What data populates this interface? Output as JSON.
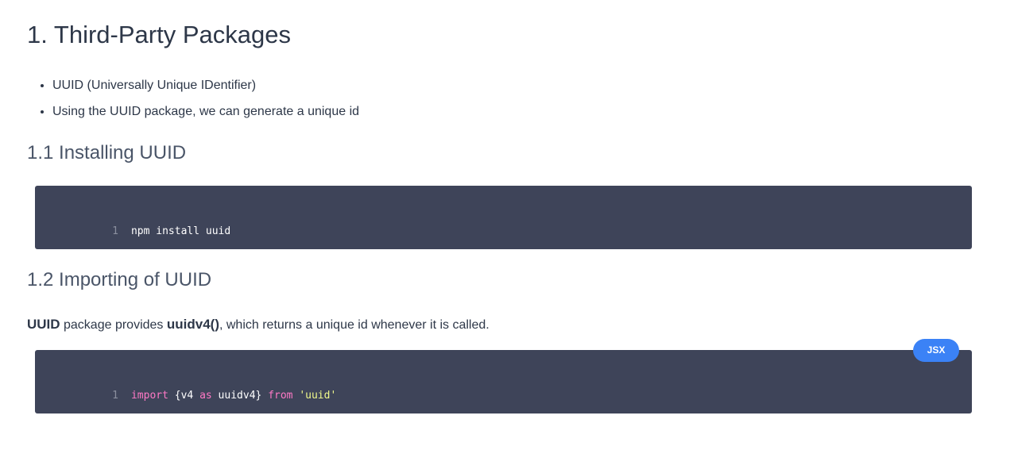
{
  "heading": "1. Third-Party Packages",
  "bullets": [
    "UUID (Universally Unique IDentifier)",
    "Using the UUID package, we can generate a unique id"
  ],
  "section1": {
    "title": "1.1 Installing UUID",
    "code": {
      "line_number": "1",
      "text": "npm install uuid"
    }
  },
  "section2": {
    "title": "1.2 Importing of UUID",
    "paragraph": {
      "bold1": "UUID",
      "text1": " package provides ",
      "bold2": "uuidv4()",
      "text2": ", which returns a unique id whenever it is called."
    },
    "code": {
      "language_badge": "JSX",
      "line_number": "1",
      "tokens": {
        "kw_import": "import",
        "braces": " {v4 ",
        "kw_as": "as",
        "name": " uuidv4} ",
        "kw_from": "from",
        "space": " ",
        "string": "'uuid'"
      }
    }
  },
  "colors": {
    "code_bg": "#3e4459",
    "keyword": "#ff79c6",
    "string": "#f1fa8c",
    "badge": "#3b82f6"
  }
}
